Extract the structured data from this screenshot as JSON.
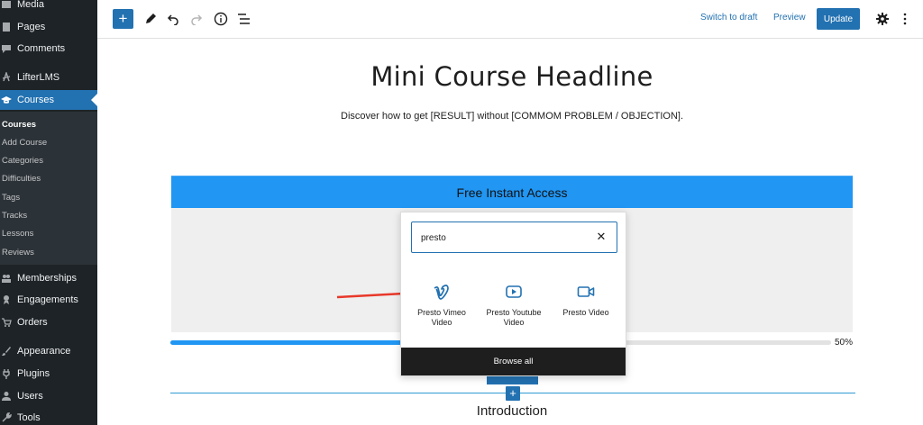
{
  "sidebar": {
    "items": [
      {
        "label": "Media",
        "icon": "media-icon"
      },
      {
        "label": "Pages",
        "icon": "pages-icon"
      },
      {
        "label": "Comments",
        "icon": "comments-icon"
      },
      {
        "label": "LifterLMS",
        "icon": "lifterlms-icon"
      },
      {
        "label": "Courses",
        "icon": "graduation-cap-icon"
      },
      {
        "label": "Memberships",
        "icon": "memberships-icon"
      },
      {
        "label": "Engagements",
        "icon": "engagements-icon"
      },
      {
        "label": "Orders",
        "icon": "cart-icon"
      },
      {
        "label": "Appearance",
        "icon": "brush-icon"
      },
      {
        "label": "Plugins",
        "icon": "plug-icon"
      },
      {
        "label": "Users",
        "icon": "users-icon"
      },
      {
        "label": "Tools",
        "icon": "wrench-icon"
      }
    ],
    "submenu": [
      "Courses",
      "Add Course",
      "Categories",
      "Difficulties",
      "Tags",
      "Tracks",
      "Lessons",
      "Reviews"
    ]
  },
  "toolbar": {
    "switch_to_draft": "Switch to draft",
    "preview": "Preview",
    "update": "Update",
    "add_block": "+"
  },
  "content": {
    "headline": "Mini Course Headline",
    "subhead": "Discover how to get [RESULT] without [COMMOM PROBLEM / OBJECTION].",
    "cta_bar": "Free Instant Access",
    "progress_label": "50%",
    "progress_value": 0.5,
    "section_title": "Introduction"
  },
  "inserter": {
    "search_value": "presto",
    "blocks": [
      {
        "label": "Presto Vimeo Video",
        "icon": "vimeo-icon"
      },
      {
        "label": "Presto Youtube Video",
        "icon": "youtube-icon"
      },
      {
        "label": "Presto Video",
        "icon": "video-camera-icon"
      }
    ],
    "browse_all": "Browse all"
  },
  "colors": {
    "accent": "#2271b1",
    "sidebar_bg": "#1d2327",
    "cta_blue": "#2196f3",
    "arrow_red": "#e8382a"
  }
}
